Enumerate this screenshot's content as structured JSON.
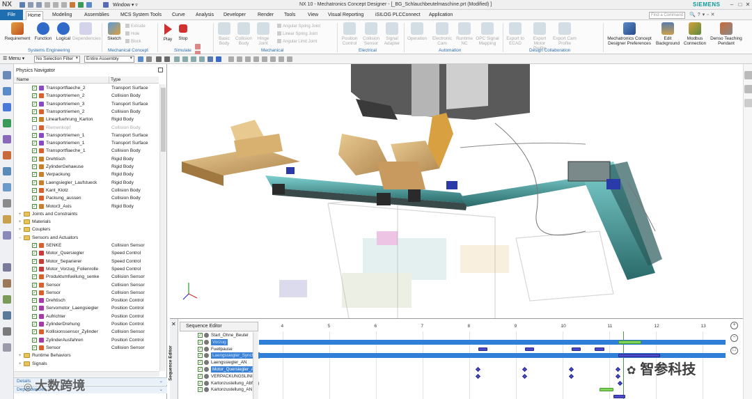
{
  "app": {
    "logo": "NX",
    "window_menu": "Window",
    "title": "NX 10 - Mechatronics Concept Designer - [_BG_Schlauchbeutelmaschine.prt (Modified) ]",
    "brand": "SIEMENS",
    "accent": "#1f6fb0",
    "brand_color": "#0a9a9a"
  },
  "tabs": {
    "file": "File",
    "items": [
      "Home",
      "Modeling",
      "Assemblies",
      "MCS System Tools",
      "Curve",
      "Analysis",
      "Developer",
      "Render",
      "Tools",
      "View",
      "Visual Reporting",
      "iSILOG PLCConnect",
      "Application"
    ],
    "active": "Home"
  },
  "search": {
    "placeholder": "Find a Command"
  },
  "ribbon": {
    "requirement": "Requirement",
    "function": "Function",
    "logical": "Logical",
    "dependencies": "Dependencies",
    "sketch": "Sketch",
    "extrude": "Extrude",
    "hole": "Hole",
    "block": "Block",
    "play": "Play",
    "stop": "Stop",
    "basic_body": "Basic Body",
    "collision_body": "Collision Body",
    "hinge_joint": "Hinge Joint",
    "angular_spring_joint": "Angular Spring Joint",
    "linear_spring_joint": "Linear Spring Joint",
    "angular_limit_joint": "Angular Limit Joint",
    "position_control": "Position Control",
    "collision_sensor": "Collision Sensor",
    "signal_adapter": "Signal Adapter",
    "operation": "Operation",
    "electronic_cam": "Electronic Cam",
    "runtime_nc": "Runtime NC",
    "opc_signal_mapping": "OPC Signal Mapping",
    "export_to_ecad": "Export to ECAD",
    "export_motor_profile": "Export Motor Profile",
    "export_cam_profile": "Export Cam Profile",
    "mcd_preferences": "Mechatronics Concept Designer Preferences",
    "edit_background": "Edit Background",
    "modbus_connection": "Modbus Connection",
    "denso_teaching_pendant": "Denso Teaching Pendant",
    "groups": [
      "Systems Engineering",
      "Mechanical Concept",
      "Simulate",
      "Mechanical",
      "Electrical",
      "Automation",
      "Design Collaboration"
    ]
  },
  "selection_bar": {
    "menu": "Menu",
    "filter": "No Selection Filter",
    "scope": "Entire Assembly"
  },
  "navigator": {
    "title": "Physics Navigator",
    "col_name": "Name",
    "col_type": "Type",
    "rows": [
      {
        "name": "Transportflaeche_2",
        "type": "Transport Surface",
        "on": true
      },
      {
        "name": "Transportriemen_2",
        "type": "Collision Body",
        "on": true
      },
      {
        "name": "Transportriemen_3",
        "type": "Transport Surface",
        "on": true
      },
      {
        "name": "Transportriemen_2",
        "type": "Collision Body",
        "on": true
      },
      {
        "name": "Linearfuehrung_Karton",
        "type": "Rigid Body",
        "on": true
      },
      {
        "name": "Riemenkopf",
        "type": "Collision Body",
        "on": false
      },
      {
        "name": "Transportriemen_1",
        "type": "Transport Surface",
        "on": true
      },
      {
        "name": "Transportriemen_1",
        "type": "Transport Surface",
        "on": true
      },
      {
        "name": "Transportflaeche_1",
        "type": "Collision Body",
        "on": true
      },
      {
        "name": "Drehtisch",
        "type": "Rigid Body",
        "on": true
      },
      {
        "name": "ZylinderGehaeuse",
        "type": "Rigid Body",
        "on": true
      },
      {
        "name": "Verpackung",
        "type": "Rigid Body",
        "on": true
      },
      {
        "name": "Laengsiegler_Laufstueck",
        "type": "Rigid Body",
        "on": true
      },
      {
        "name": "Kant_Klotz",
        "type": "Collision Body",
        "on": true
      },
      {
        "name": "Packung_aussen",
        "type": "Collision Body",
        "on": true
      },
      {
        "name": "Motor3_Axis",
        "type": "Rigid Body",
        "on": true
      }
    ],
    "folders_mid": [
      "Joints and Constraints",
      "Materials",
      "Couplers",
      "Sensors and Actuators"
    ],
    "sensor_rows": [
      {
        "name": "SENKE",
        "type": "Collision Sensor"
      },
      {
        "name": "Motor_Quersiegler",
        "type": "Speed Control"
      },
      {
        "name": "Motor_Separierer",
        "type": "Speed Control"
      },
      {
        "name": "Motor_Vorzug_Folienrolle",
        "type": "Speed Control"
      },
      {
        "name": "Produktumfuellung_senke",
        "type": "Collision Sensor"
      },
      {
        "name": "Sensor",
        "type": "Collision Sensor"
      },
      {
        "name": "Sensor",
        "type": "Collision Sensor"
      },
      {
        "name": "Drehtisch",
        "type": "Position Control"
      },
      {
        "name": "Servomotor_Laengsiegler",
        "type": "Position Control"
      },
      {
        "name": "Aufrichter",
        "type": "Position Control"
      },
      {
        "name": "ZylinderDrehung",
        "type": "Position Control"
      },
      {
        "name": "Kollisionssensor_Zylinder",
        "type": "Collision Sensor"
      },
      {
        "name": "ZylinderAusfahren",
        "type": "Position Control"
      },
      {
        "name": "Sensor",
        "type": "Collision Sensor"
      }
    ],
    "folders_end": [
      "Runtime Behaviors",
      "Signals"
    ],
    "panel_details": "Details",
    "panel_dependencies": "Dependencies"
  },
  "sequence_editor": {
    "title": "Sequence Editor",
    "side_label": "Sequence Editor",
    "rows": [
      {
        "name": "Start_Ohne_Beutel",
        "state": ""
      },
      {
        "name": "Vorzug",
        "state": "hl"
      },
      {
        "name": "Fuellpause",
        "state": ""
      },
      {
        "name": "Laengssiegler_Synchro",
        "state": "hl"
      },
      {
        "name": "Laengssiegler_AN",
        "state": ""
      },
      {
        "name": "Motor_Quersiegler_AN",
        "state": "sel"
      },
      {
        "name": "VERPACKUNGSLINIE",
        "state": ""
      },
      {
        "name": "Kartonzustellung_Abfrag",
        "state": ""
      },
      {
        "name": "Kartonzustellung_AN",
        "state": ""
      }
    ],
    "ticks": [
      "4",
      "5",
      "6",
      "7",
      "8",
      "9",
      "10",
      "11",
      "12",
      "13"
    ],
    "t_min": 3.5,
    "t_max": 13.5,
    "cursor_t": 11.3,
    "bands": [
      {
        "row": 1,
        "from": 3.5,
        "to": 13.5
      },
      {
        "row": 3,
        "from": 3.5,
        "to": 13.5
      }
    ],
    "bars": [
      {
        "row": 1,
        "from": 11.2,
        "to": 11.7,
        "color": "green"
      },
      {
        "row": 2,
        "from": 8.2,
        "to": 8.4,
        "color": "blue"
      },
      {
        "row": 2,
        "from": 9.2,
        "to": 9.4,
        "color": "blue"
      },
      {
        "row": 2,
        "from": 10.2,
        "to": 10.4,
        "color": "blue"
      },
      {
        "row": 2,
        "from": 10.7,
        "to": 10.9,
        "color": "blue"
      },
      {
        "row": 3,
        "from": 11.2,
        "to": 12.1,
        "color": "blue"
      },
      {
        "row": 8,
        "from": 10.8,
        "to": 11.1,
        "color": "green"
      },
      {
        "row": 9,
        "from": 11.1,
        "to": 11.35,
        "color": "blue"
      }
    ],
    "diamonds": [
      {
        "row": 5,
        "t": 8.2
      },
      {
        "row": 6,
        "t": 8.2
      },
      {
        "row": 5,
        "t": 9.2
      },
      {
        "row": 6,
        "t": 9.2
      },
      {
        "row": 5,
        "t": 10.2
      },
      {
        "row": 6,
        "t": 10.2
      },
      {
        "row": 5,
        "t": 11.2
      },
      {
        "row": 6,
        "t": 11.2
      },
      {
        "row": 7,
        "t": 11.25
      }
    ]
  },
  "watermarks": {
    "left": "大数跨境",
    "right": "智参科技"
  }
}
